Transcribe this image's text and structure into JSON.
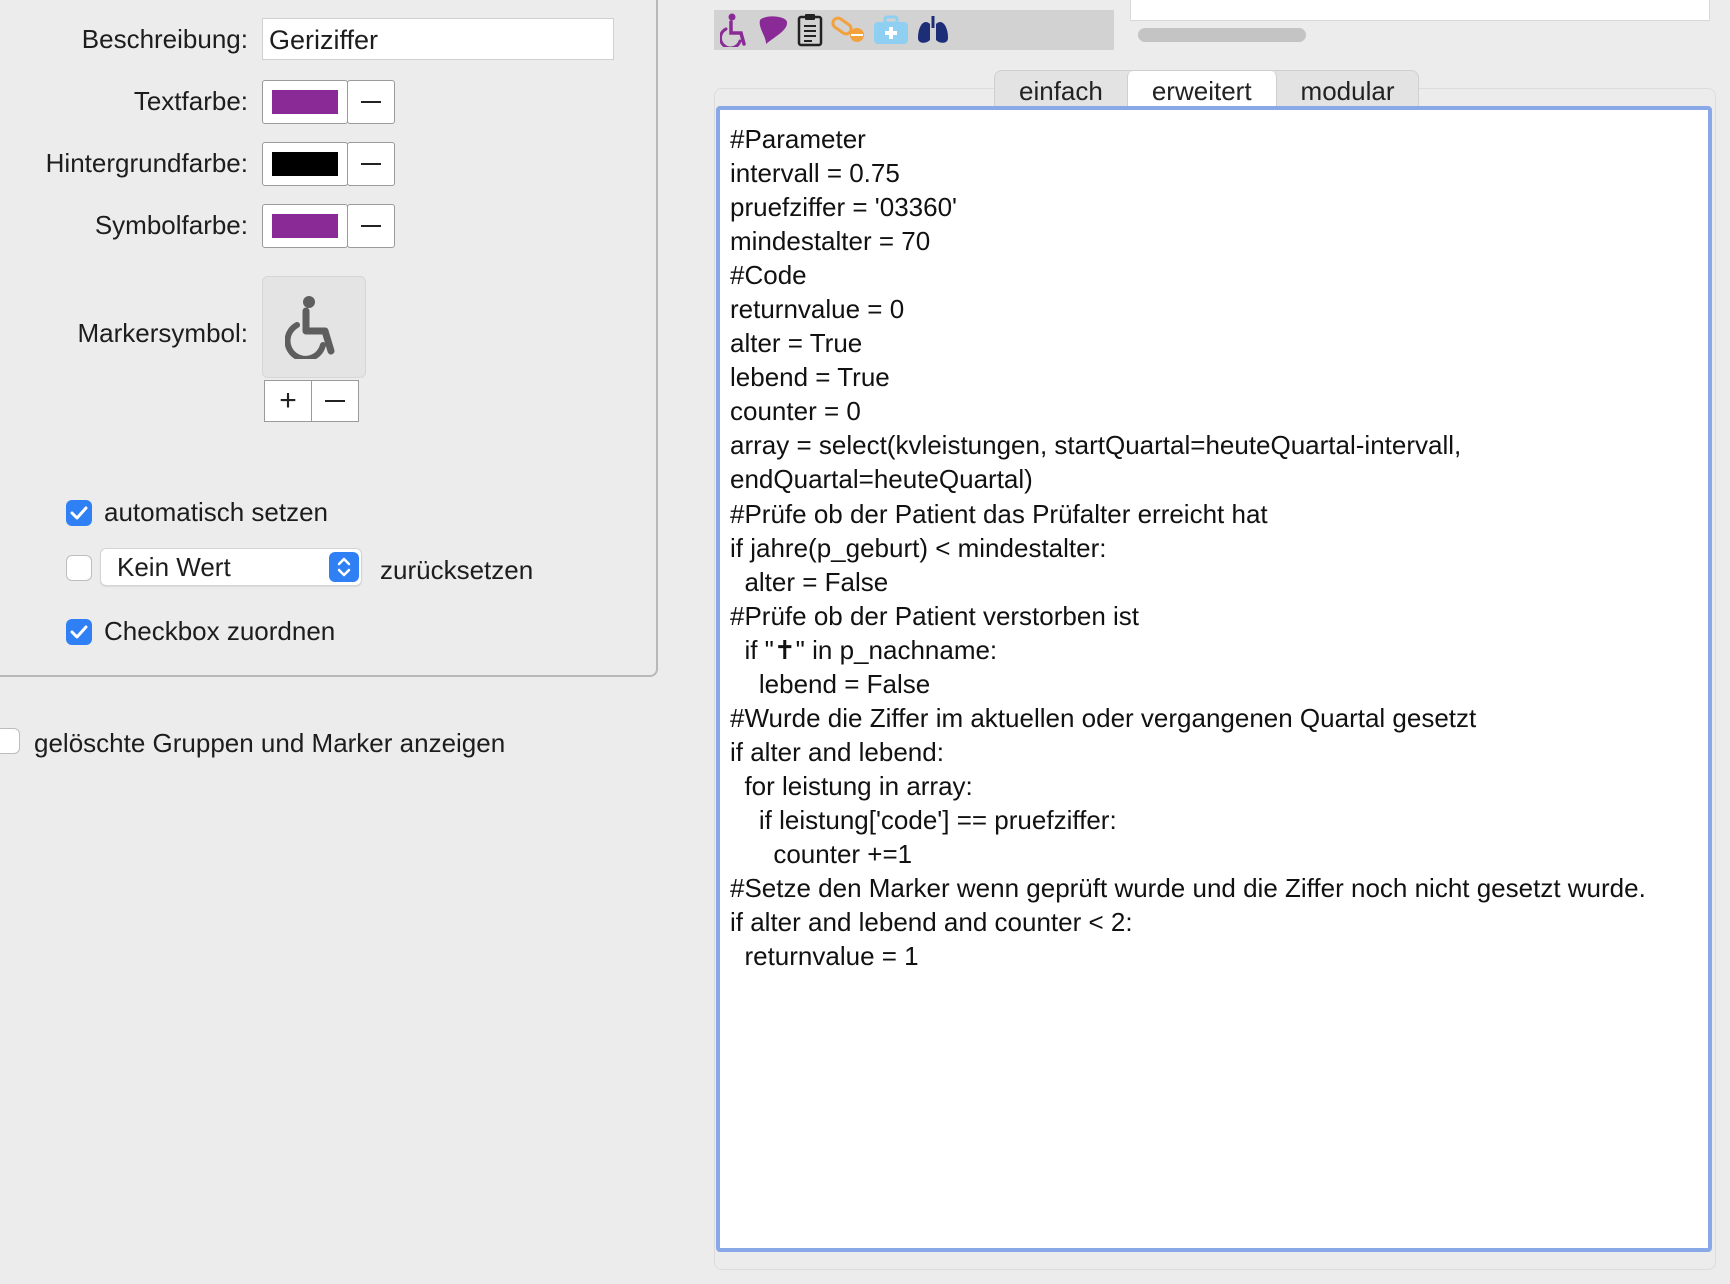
{
  "left_panel": {
    "description_label": "Beschreibung:",
    "description_value": "Geriziffer",
    "text_color_label": "Textfarbe:",
    "text_color": "#8a2a96",
    "background_color_label": "Hintergrundfarbe:",
    "background_color": "#000000",
    "symbol_color_label": "Symbolfarbe:",
    "symbol_color": "#8a2a96",
    "marker_symbol_label": "Markersymbol:",
    "marker_symbol_icon": "wheelchair-icon",
    "add_symbol_label": "+",
    "auto_set_checked": true,
    "auto_set_label": "automatisch setzen",
    "reset_checked": false,
    "reset_value": "Kein Wert",
    "reset_label": "zurücksetzen",
    "assign_checkbox_checked": true,
    "assign_checkbox_label": "Checkbox zuordnen"
  },
  "show_deleted_checked": false,
  "show_deleted_label": "gelöschte Gruppen und Marker anzeigen",
  "toolbar": {
    "icons": [
      "wheelchair-icon",
      "heart-icon",
      "clipboard-icon",
      "pills-icon",
      "first-aid-kit-icon",
      "lungs-icon"
    ]
  },
  "tabs": {
    "simple": "einfach",
    "advanced": "erweitert",
    "modular": "modular",
    "selected": "erweitert"
  },
  "editor": {
    "code": "#Parameter\nintervall = 0.75\npruefziffer = '03360'\nmindestalter = 70\n#Code\nreturnvalue = 0\nalter = True\nlebend = True\ncounter = 0\narray = select(kvleistungen, startQuartal=heuteQuartal-intervall,\nendQuartal=heuteQuartal)\n#Prüfe ob der Patient das Prüfalter erreicht hat\nif jahre(p_geburt) < mindestalter:\n  alter = False\n#Prüfe ob der Patient verstorben ist\n  if \"✝\" in p_nachname:\n    lebend = False\n#Wurde die Ziffer im aktuellen oder vergangenen Quartal gesetzt\nif alter and lebend:\n  for leistung in array:\n    if leistung['code'] == pruefziffer:\n      counter +=1\n#Setze den Marker wenn geprüft wurde und die Ziffer noch nicht gesetzt wurde.\nif alter and lebend and counter < 2:\n  returnvalue = 1"
  },
  "colors": {
    "accent": "#2f7ff5",
    "editor_focus_ring": "#88a8e8",
    "marker_purple": "#8a2a96"
  }
}
